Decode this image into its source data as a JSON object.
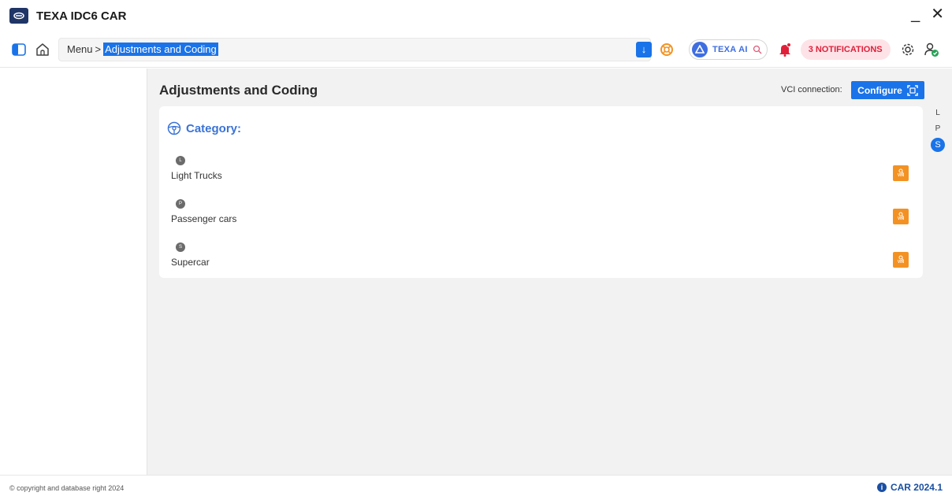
{
  "window": {
    "title": "TEXA IDC6 CAR",
    "minimize_label": "_",
    "close_label": "✕"
  },
  "toolbar": {
    "breadcrumb": {
      "menu": "Menu",
      "separator": ">",
      "current": "Adjustments and Coding"
    },
    "ai_label": "TEXA AI",
    "notifications_label": "3 NOTIFICATIONS"
  },
  "main": {
    "title": "Adjustments and Coding",
    "vci_label": "VCI connection:",
    "configure_label": "Configure",
    "category_title": "Category:",
    "categories": [
      {
        "letter": "L",
        "name": "Light Trucks",
        "vin_label": "VIN"
      },
      {
        "letter": "P",
        "name": "Passenger cars",
        "vin_label": "VIN"
      },
      {
        "letter": "S",
        "name": "Supercar",
        "vin_label": "VIN"
      }
    ],
    "alpha_index": [
      "L",
      "P",
      "S"
    ],
    "alpha_active": "S"
  },
  "footer": {
    "copyright": "© copyright and database right 2024",
    "version": "CAR 2024.1"
  },
  "colors": {
    "accent": "#1a73e8",
    "brand_dark": "#1f3566",
    "vin_orange": "#f39223",
    "notification_red": "#e0203a"
  }
}
